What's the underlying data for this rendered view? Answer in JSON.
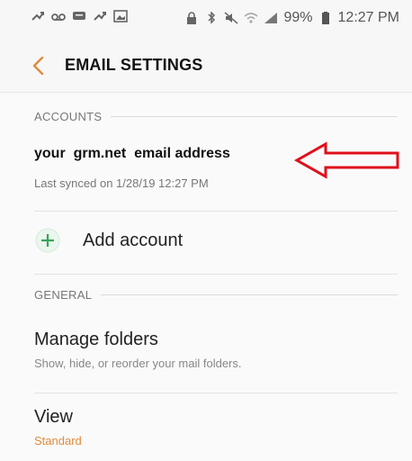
{
  "status_bar": {
    "battery": "99%",
    "time": "12:27 PM",
    "left_icons": [
      "missed-call-icon",
      "voicemail-icon",
      "message-icon",
      "missed-call-icon",
      "image-icon"
    ],
    "right_icons": [
      "lock-icon",
      "bluetooth-icon",
      "mute-icon",
      "wifi-icon",
      "signal-icon",
      "battery-icon"
    ]
  },
  "header": {
    "back_icon": "chevron-left-icon",
    "title": "EMAIL SETTINGS"
  },
  "accounts_section": {
    "header": "ACCOUNTS",
    "account": {
      "email": "your  grm.net  email address",
      "sync": "Last synced on 1/28/19  12:27 PM"
    },
    "annotation_arrow_color": "#e0101a",
    "add_account": {
      "icon": "plus-icon",
      "label": "Add account",
      "icon_color": "#3aa35a"
    }
  },
  "general_section": {
    "header": "GENERAL",
    "manage_folders": {
      "title": "Manage folders",
      "subtitle": "Show, hide, or reorder your mail folders."
    },
    "view": {
      "title": "View",
      "value": "Standard",
      "value_color": "#e08a3c"
    }
  }
}
